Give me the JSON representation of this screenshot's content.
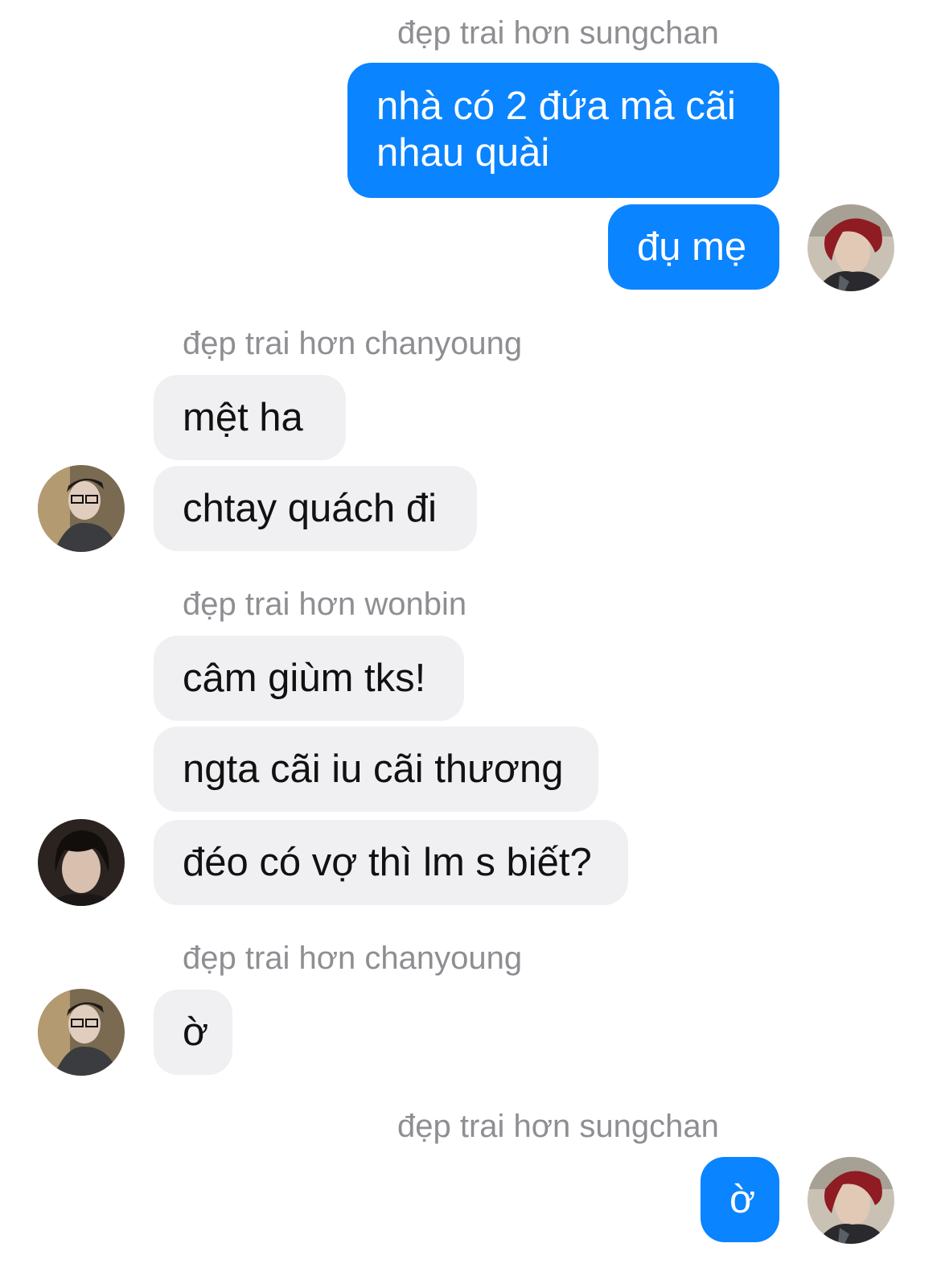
{
  "messages": [
    {
      "sender": "đẹp trai hơn sungchan",
      "direction": "outgoing",
      "bubbles": [
        "nhà có 2 đứa mà cãi nhau quài",
        "đụ mẹ"
      ],
      "avatar": "avatar-sungchan"
    },
    {
      "sender": "đẹp trai hơn chanyoung",
      "direction": "incoming",
      "bubbles": [
        "mệt ha",
        "chtay quách đi"
      ],
      "avatar": "avatar-chanyoung"
    },
    {
      "sender": "đẹp trai hơn wonbin",
      "direction": "incoming",
      "bubbles": [
        "câm giùm tks!",
        "ngta cãi iu cãi thương",
        "đéo có vợ thì lm s biết?"
      ],
      "avatar": "avatar-wonbin"
    },
    {
      "sender": "đẹp trai hơn chanyoung",
      "direction": "incoming",
      "bubbles": [
        "ờ"
      ],
      "avatar": "avatar-chanyoung"
    },
    {
      "sender": "đẹp trai hơn sungchan",
      "direction": "outgoing",
      "bubbles": [
        "ờ"
      ],
      "avatar": "avatar-sungchan"
    }
  ],
  "colors": {
    "outgoing_bubble": "#0a84ff",
    "incoming_bubble": "#f0f0f2",
    "sender_name": "#8e8e93"
  }
}
